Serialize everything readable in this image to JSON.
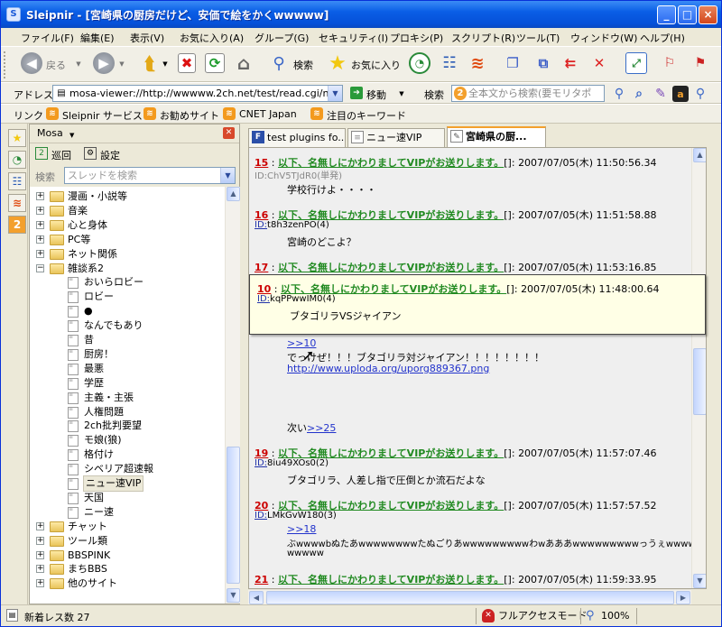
{
  "window": {
    "title": "Sleipnir - [宮崎県の厨房だけど、安価で絵をかくwwwww]",
    "min_glyph": "_",
    "max_glyph": "□",
    "close_glyph": "×"
  },
  "menubar": {
    "items": [
      "ファイル(F)",
      "編集(E)",
      "表示(V)",
      "お気に入り(A)",
      "グループ(G)",
      "セキュリティ(I)",
      "プロキシ(P)",
      "スクリプト(R)",
      "ツール(T)",
      "ウィンドウ(W)",
      "ヘルプ(H)"
    ]
  },
  "toolbar": {
    "back_label": "戻る",
    "search_label": "検索",
    "favorites_label": "お気に入り"
  },
  "addressbar": {
    "label": "アドレス",
    "url": "mosa-viewer://http://wwwww.2ch.net/test/read.cgi/ne",
    "go_label": "移動",
    "search_label": "検索",
    "search_placeholder": "全本文から検索(要モリタポ"
  },
  "linksbar": {
    "label": "リンク",
    "items": [
      "Sleipnir サービス",
      "お勧めサイト",
      "CNET Japan",
      "注目のキーワード"
    ]
  },
  "panel": {
    "title": "Mosa",
    "patrol_label": "巡回",
    "settings_label": "設定",
    "search_label": "検索",
    "search_placeholder": "スレッドを検索"
  },
  "tree": {
    "items": [
      {
        "label": "漫画・小説等",
        "type": "folder",
        "expanded": false
      },
      {
        "label": "音楽",
        "type": "folder",
        "expanded": false
      },
      {
        "label": "心と身体",
        "type": "folder",
        "expanded": false
      },
      {
        "label": "PC等",
        "type": "folder",
        "expanded": false
      },
      {
        "label": "ネット関係",
        "type": "folder",
        "expanded": false
      },
      {
        "label": "雑談系2",
        "type": "folder",
        "expanded": true
      },
      {
        "label": "おいらロビー",
        "type": "board"
      },
      {
        "label": "ロビー",
        "type": "board"
      },
      {
        "label": "●",
        "type": "board"
      },
      {
        "label": "なんでもあり",
        "type": "board"
      },
      {
        "label": "昔",
        "type": "board"
      },
      {
        "label": "厨房！",
        "type": "board"
      },
      {
        "label": "最悪",
        "type": "board"
      },
      {
        "label": "学歴",
        "type": "board"
      },
      {
        "label": "主義・主張",
        "type": "board"
      },
      {
        "label": "人権問題",
        "type": "board"
      },
      {
        "label": "2ch批判要望",
        "type": "board"
      },
      {
        "label": "モ娘(狼)",
        "type": "board"
      },
      {
        "label": "格付け",
        "type": "board"
      },
      {
        "label": "シベリア超速報",
        "type": "board"
      },
      {
        "label": "ニュー速VIP",
        "type": "board",
        "selected": true
      },
      {
        "label": "天国",
        "type": "board"
      },
      {
        "label": "ニー速",
        "type": "board"
      },
      {
        "label": "チャット",
        "type": "folder",
        "expanded": false
      },
      {
        "label": "ツール類",
        "type": "folder",
        "expanded": false
      },
      {
        "label": "BBSPINK",
        "type": "folder",
        "expanded": false
      },
      {
        "label": "まちBBS",
        "type": "folder",
        "expanded": false
      },
      {
        "label": "他のサイト",
        "type": "folder",
        "expanded": false
      }
    ]
  },
  "tabs": [
    {
      "label": "test plugins fo...",
      "icon": "F",
      "active": false
    },
    {
      "label": "ニュー速VIP",
      "icon": "",
      "active": false
    },
    {
      "label": "宮崎県の厨...",
      "icon": "",
      "active": true
    }
  ],
  "posts": [
    {
      "num": "15",
      "name": "以下、名無しにかわりましてVIPがお送りします。",
      "mail": "",
      "date": "2007/07/05(木) 11:50:56.34",
      "id_prefix": "ID:",
      "id": "ChV5TJdR0(単発)",
      "body": [
        "学校行けよ・・・・"
      ]
    },
    {
      "num": "16",
      "name": "以下、名無しにかわりましてVIPがお送りします。",
      "mail": "",
      "date": "2007/07/05(木) 11:51:58.88",
      "id_prefix": "ID:",
      "id": "t8h3zenPO(4)",
      "body": [
        "宮崎のどこよ？"
      ]
    },
    {
      "num": "17",
      "name": "以下、名無しにかわりましてVIPがお送りします。",
      "mail": "",
      "date": "2007/07/05(木) 11:53:16.85",
      "id_prefix": "",
      "id": "",
      "body": []
    },
    {
      "num": "",
      "name": "",
      "mail": "",
      "date": "",
      "id_prefix": "",
      "id": "",
      "anchor": ">>10",
      "body": [
        "でっけぜ！！！ブタゴリラ対ジャイアン！！！！！！！！"
      ],
      "link": "http://www.uploda.org/uporg889367.png",
      "next_label": "次い",
      "next_anchor": ">>25"
    },
    {
      "num": "19",
      "name": "以下、名無しにかわりましてVIPがお送りします。",
      "mail": "",
      "date": "2007/07/05(木) 11:57:07.46",
      "id_prefix": "ID:",
      "id": "8iu49XOs0(2)",
      "body": [
        "ブタゴリラ、人差し指で圧倒とか流石だよな"
      ]
    },
    {
      "num": "20",
      "name": "以下、名無しにかわりましてVIPがお送りします。",
      "mail": "",
      "date": "2007/07/05(木) 11:57:57.52",
      "id_prefix": "ID:",
      "id": "LMkGvW180(3)",
      "anchor": ">>18",
      "body": [
        "ぶwwwwbぬたあwwwwwwwwたぬごりあwwwwwwwwwわwあああwwwwwwwwwっうぇwwwwwwwwww",
        "wwwww"
      ]
    },
    {
      "num": "21",
      "name": "以下、名無しにかわりましてVIPがお送りします。",
      "mail": "",
      "date": "2007/07/05(木) 11:59:33.95",
      "id_prefix": "",
      "id": "",
      "body": []
    }
  ],
  "popup": {
    "num": "10",
    "name": "以下、名無しにかわりましてVIPがお送りします。",
    "date": "2007/07/05(木) 11:48:00.64",
    "id_prefix": "ID:",
    "id": "kqPPwwIM0(4)",
    "body": "ブタゴリラVSジャイアン"
  },
  "status": {
    "new_count": "新着レス数 27",
    "access_mode": "フルアクセスモード",
    "zoom": "100%"
  }
}
